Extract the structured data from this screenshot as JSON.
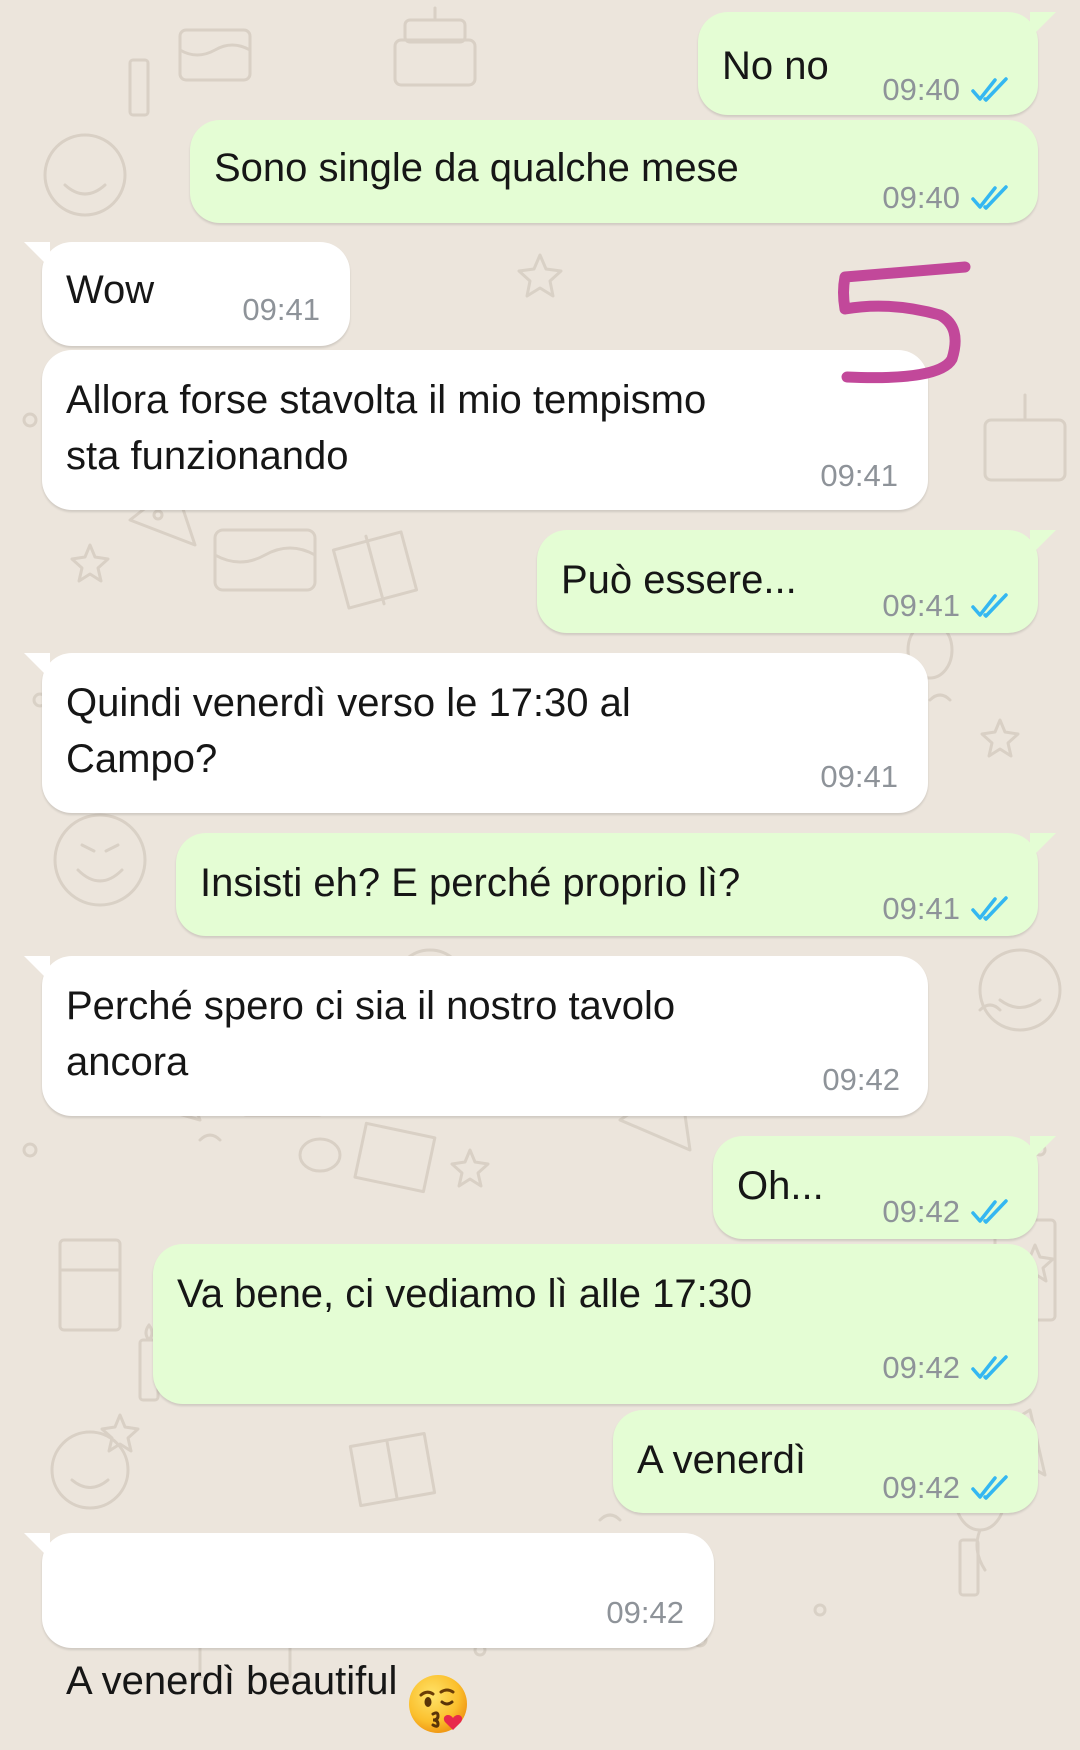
{
  "chat": {
    "messages": [
      {
        "direction": "outgoing",
        "text": "No no",
        "time": "09:40",
        "status": "read"
      },
      {
        "direction": "outgoing",
        "text": "Sono single da qualche mese",
        "time": "09:40",
        "status": "read"
      },
      {
        "direction": "incoming",
        "text": "Wow",
        "time": "09:41"
      },
      {
        "direction": "incoming",
        "text": "Allora forse stavolta il mio tempismo\nsta funzionando",
        "time": "09:41"
      },
      {
        "direction": "outgoing",
        "text": "Può essere...",
        "time": "09:41",
        "status": "read"
      },
      {
        "direction": "incoming",
        "text": "Quindi venerdì verso le 17:30 al\nCampo?",
        "time": "09:41"
      },
      {
        "direction": "outgoing",
        "text": "Insisti eh? E perché proprio lì?",
        "time": "09:41",
        "status": "read"
      },
      {
        "direction": "incoming",
        "text": "Perché spero ci sia il nostro tavolo\nancora",
        "time": "09:42"
      },
      {
        "direction": "outgoing",
        "text": "Oh...",
        "time": "09:42",
        "status": "read"
      },
      {
        "direction": "outgoing",
        "text": "Va bene, ci vediamo lì alle 17:30",
        "time": "09:42",
        "status": "read"
      },
      {
        "direction": "outgoing",
        "text": "A venerdì",
        "time": "09:42",
        "status": "read"
      },
      {
        "direction": "incoming",
        "text": "A venerdì beautiful",
        "time": "09:42",
        "emoji": "face-blowing-a-kiss"
      }
    ]
  },
  "annotation": {
    "text": "5",
    "color": "#c2489a"
  },
  "colors": {
    "outgoing_bubble": "#e4fdd4",
    "incoming_bubble": "#ffffff",
    "background": "#ece5dc",
    "read_ticks": "#34b7f1",
    "timestamp": "#8e9399"
  },
  "icons": {
    "read_receipt": "double-check-icon",
    "wallpaper_doodles": "party-doodle-pattern"
  }
}
